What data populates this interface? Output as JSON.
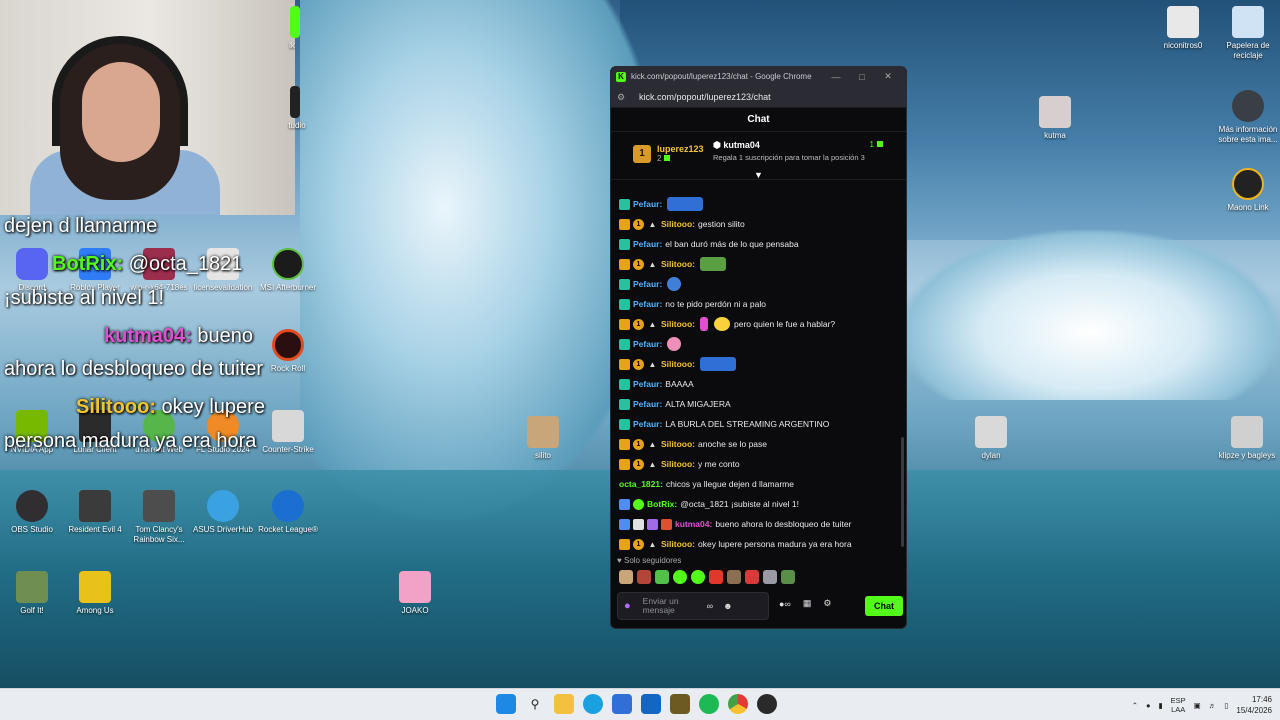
{
  "webcam": {
    "label": "webcam"
  },
  "desktop_icons": [
    {
      "label": "niconitros0"
    },
    {
      "label": "Papelera de reciclaje"
    },
    {
      "label": "kutma"
    },
    {
      "label": "Más información sobre esta ima..."
    },
    {
      "label": "Maono Link"
    },
    {
      "label": "silito"
    },
    {
      "label": "dylan"
    },
    {
      "label": "klipze y bagleys"
    },
    {
      "label": "Discord"
    },
    {
      "label": "Roblox Player"
    },
    {
      "label": "win-r-x64-718es"
    },
    {
      "label": "licensevalidation"
    },
    {
      "label": "MSI Afterburner"
    },
    {
      "label": "NVIDIA App"
    },
    {
      "label": "Lunar Client"
    },
    {
      "label": "uTorrent Web"
    },
    {
      "label": "FL Studio 2024"
    },
    {
      "label": "Counter-Strike"
    },
    {
      "label": "Rock Roll"
    },
    {
      "label": "OBS Studio"
    },
    {
      "label": "Resident Evil 4"
    },
    {
      "label": "Tom Clancy's Rainbow Six..."
    },
    {
      "label": "ASUS DriverHub"
    },
    {
      "label": "Rocket League®"
    },
    {
      "label": "Golf It!"
    },
    {
      "label": "Among Us"
    },
    {
      "label": "JOAKO"
    },
    {
      "label": "lk"
    },
    {
      "label": "tudio"
    }
  ],
  "overlay": {
    "line1": "dejen d llamarme",
    "botrix_name": "BotRix:",
    "botrix_text": "@octa_1821",
    "line3": "¡subiste al nivel 1!",
    "kutma_name": "kutma04:",
    "kutma_text": "bueno",
    "line5": "ahora lo desbloqueo de tuiter",
    "silito_name": "Silitooo:",
    "silito_text": "okey lupere",
    "line7": "persona madura ya era hora"
  },
  "window": {
    "title": "kick.com/popout/luperez123/chat - Google Chrome",
    "url": "kick.com/popout/luperez123/chat",
    "header": "Chat"
  },
  "pinned": {
    "rank": "1",
    "user": "luperez123",
    "count": "2",
    "gifter": "kutma04",
    "desc": "Regala 1 suscripción para tomar la posición 3",
    "gift_count": "1"
  },
  "messages": [
    {
      "user": "Pefaur:",
      "text": "",
      "color": "#4fb3ff"
    },
    {
      "user": "Silitooo:",
      "text": "gestion silito",
      "color": "#f4c430"
    },
    {
      "user": "Pefaur:",
      "text": "el ban duró más de lo que pensaba",
      "color": "#4fb3ff"
    },
    {
      "user": "Silitooo:",
      "text": "",
      "color": "#f4c430"
    },
    {
      "user": "Pefaur:",
      "text": "",
      "color": "#4fb3ff"
    },
    {
      "user": "Pefaur:",
      "text": "no te pido perdón ni a palo",
      "color": "#4fb3ff"
    },
    {
      "user": "Silitooo:",
      "text": "pero quien le fue a hablar?",
      "color": "#f4c430"
    },
    {
      "user": "Pefaur:",
      "text": "",
      "color": "#4fb3ff"
    },
    {
      "user": "Silitooo:",
      "text": "",
      "color": "#f4c430"
    },
    {
      "user": "Pefaur:",
      "text": "BAAAA",
      "color": "#4fb3ff"
    },
    {
      "user": "Pefaur:",
      "text": "ALTA MIGAJERA",
      "color": "#4fb3ff"
    },
    {
      "user": "Pefaur:",
      "text": "LA BURLA DEL STREAMING ARGENTINO",
      "color": "#4fb3ff"
    },
    {
      "user": "Silitooo:",
      "text": "anoche se lo pase",
      "color": "#f4c430"
    },
    {
      "user": "Silitooo:",
      "text": "y me conto",
      "color": "#f4c430"
    },
    {
      "user": "octa_1821:",
      "text": "chicos ya llegue dejen d llamarme",
      "color": "#53fc18"
    },
    {
      "user": "BotRix:",
      "text": "@octa_1821 ¡subiste al nivel 1!",
      "color": "#53fc18"
    },
    {
      "user": "kutma04:",
      "text": "bueno ahora lo desbloqueo de tuiter",
      "color": "#e24fd0"
    },
    {
      "user": "Silitooo:",
      "text": "okey lupere persona madura ya era hora",
      "color": "#f4c430"
    }
  ],
  "followers_only": "Solo seguidores",
  "input": {
    "placeholder": "Enviar un mensaje"
  },
  "send_label": "Chat",
  "tray": {
    "lang1": "ESP",
    "lang2": "LAA",
    "time": "17:46",
    "date": "15/4/2026"
  },
  "colors": {
    "kick_green": "#53fc18",
    "window_bg": "#0b0b0d",
    "taskbar": "#e9edf2"
  }
}
